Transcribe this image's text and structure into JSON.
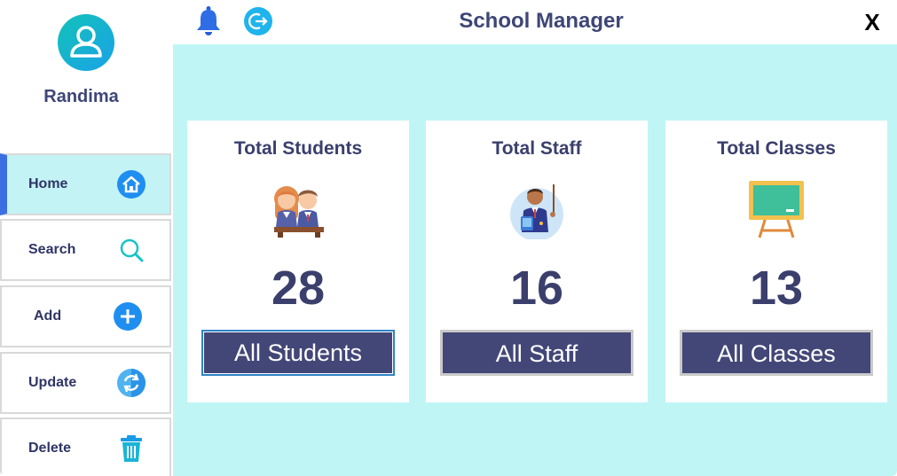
{
  "app": {
    "title": "School Manager",
    "close_label": "X"
  },
  "user": {
    "name": "Randima"
  },
  "nav": [
    {
      "label": "Home",
      "icon": "home-icon",
      "active": true
    },
    {
      "label": "Search",
      "icon": "search-icon",
      "active": false
    },
    {
      "label": "Add",
      "icon": "add-icon",
      "active": false
    },
    {
      "label": "Update",
      "icon": "update-icon",
      "active": false
    },
    {
      "label": "Delete",
      "icon": "trash-icon",
      "active": false
    }
  ],
  "cards": [
    {
      "title": "Total Students",
      "count": "28",
      "button": "All Students",
      "icon": "students-icon"
    },
    {
      "title": "Total Staff",
      "count": "16",
      "button": "All Staff",
      "icon": "teacher-icon"
    },
    {
      "title": "Total Classes",
      "count": "13",
      "button": "All Classes",
      "icon": "blackboard-icon"
    }
  ],
  "colors": {
    "accent": "#3b6fe2",
    "main_bg": "#c0f5f6",
    "button_bg": "#434777",
    "text": "#3e4676"
  }
}
